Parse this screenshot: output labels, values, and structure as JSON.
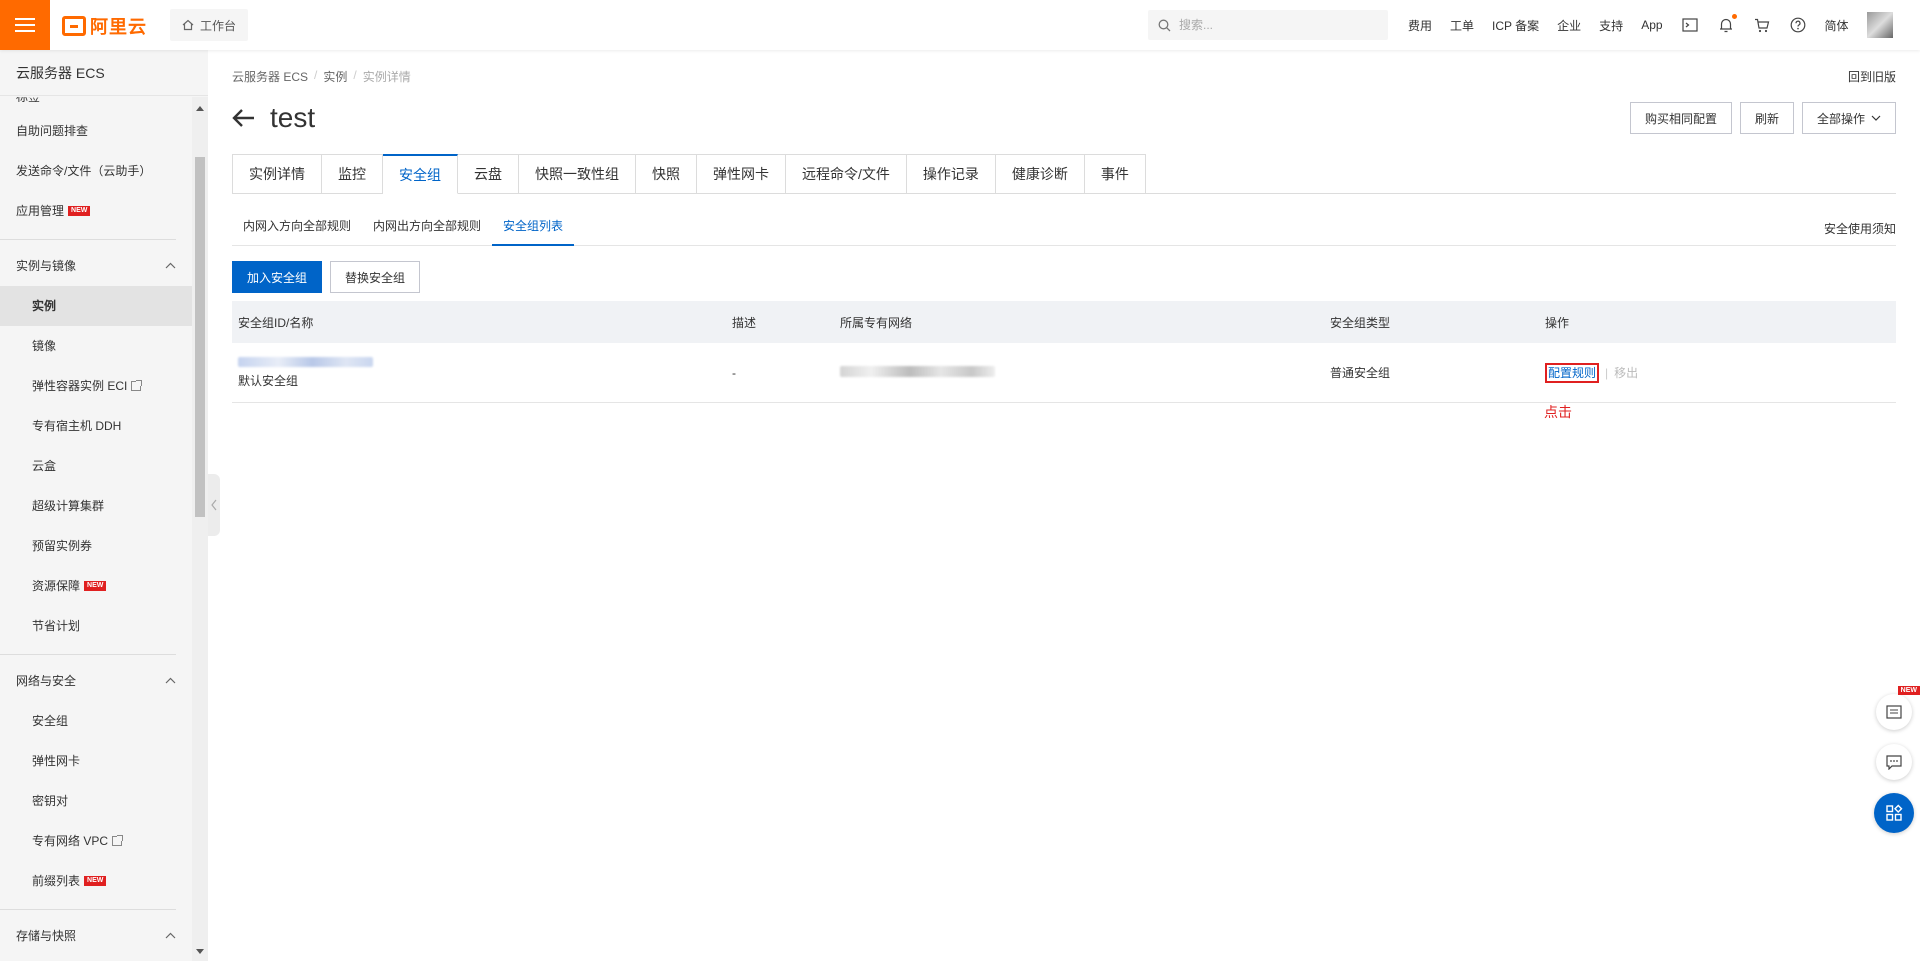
{
  "topbar": {
    "logo_text": "阿里云",
    "workbench_label": "工作台",
    "search_placeholder": "搜索...",
    "nav": [
      "费用",
      "工单",
      "ICP 备案",
      "企业",
      "支持",
      "App"
    ],
    "lang_label": "简体",
    "accent_color": "#ff6a00"
  },
  "sidebar": {
    "title": "云服务器 ECS",
    "partial_top_label": "标签",
    "items_top": [
      {
        "label": "自助问题排查"
      },
      {
        "label": "发送命令/文件（云助手）"
      },
      {
        "label": "应用管理",
        "badge": "NEW"
      }
    ],
    "group1": {
      "label": "实例与镜像",
      "items": [
        {
          "label": "实例"
        },
        {
          "label": "镜像"
        },
        {
          "label": "弹性容器实例 ECI"
        },
        {
          "label": "专有宿主机 DDH"
        },
        {
          "label": "云盒"
        },
        {
          "label": "超级计算集群"
        },
        {
          "label": "预留实例券"
        },
        {
          "label": "资源保障",
          "badge": "NEW"
        },
        {
          "label": "节省计划"
        }
      ]
    },
    "group2": {
      "label": "网络与安全",
      "items": [
        {
          "label": "安全组"
        },
        {
          "label": "弹性网卡"
        },
        {
          "label": "密钥对"
        },
        {
          "label": "专有网络 VPC"
        },
        {
          "label": "前缀列表",
          "badge": "NEW"
        }
      ]
    },
    "group3": {
      "label": "存储与快照"
    }
  },
  "breadcrumb": [
    "云服务器 ECS",
    "实例",
    "实例详情"
  ],
  "back_old_label": "回到旧版",
  "page_title": "test",
  "actions": {
    "buy_same": "购买相同配置",
    "refresh": "刷新",
    "all_ops": "全部操作"
  },
  "tabs": [
    "实例详情",
    "监控",
    "安全组",
    "云盘",
    "快照一致性组",
    "快照",
    "弹性网卡",
    "远程命令/文件",
    "操作记录",
    "健康诊断",
    "事件"
  ],
  "active_tab": "安全组",
  "subtabs": [
    "内网入方向全部规则",
    "内网出方向全部规则",
    "安全组列表"
  ],
  "active_subtab": "安全组列表",
  "notice_label": "安全使用须知",
  "buttons": {
    "join_sg": "加入安全组",
    "replace_sg": "替换安全组"
  },
  "table": {
    "headers": [
      "安全组ID/名称",
      "描述",
      "所属专有网络",
      "安全组类型",
      "操作"
    ],
    "rows": [
      {
        "name": "默认安全组",
        "desc": "-",
        "type": "普通安全组",
        "op_config": "配置规则",
        "op_remove": "移出"
      }
    ]
  },
  "annotation": "点击",
  "floating": {
    "new_badge": "NEW"
  }
}
